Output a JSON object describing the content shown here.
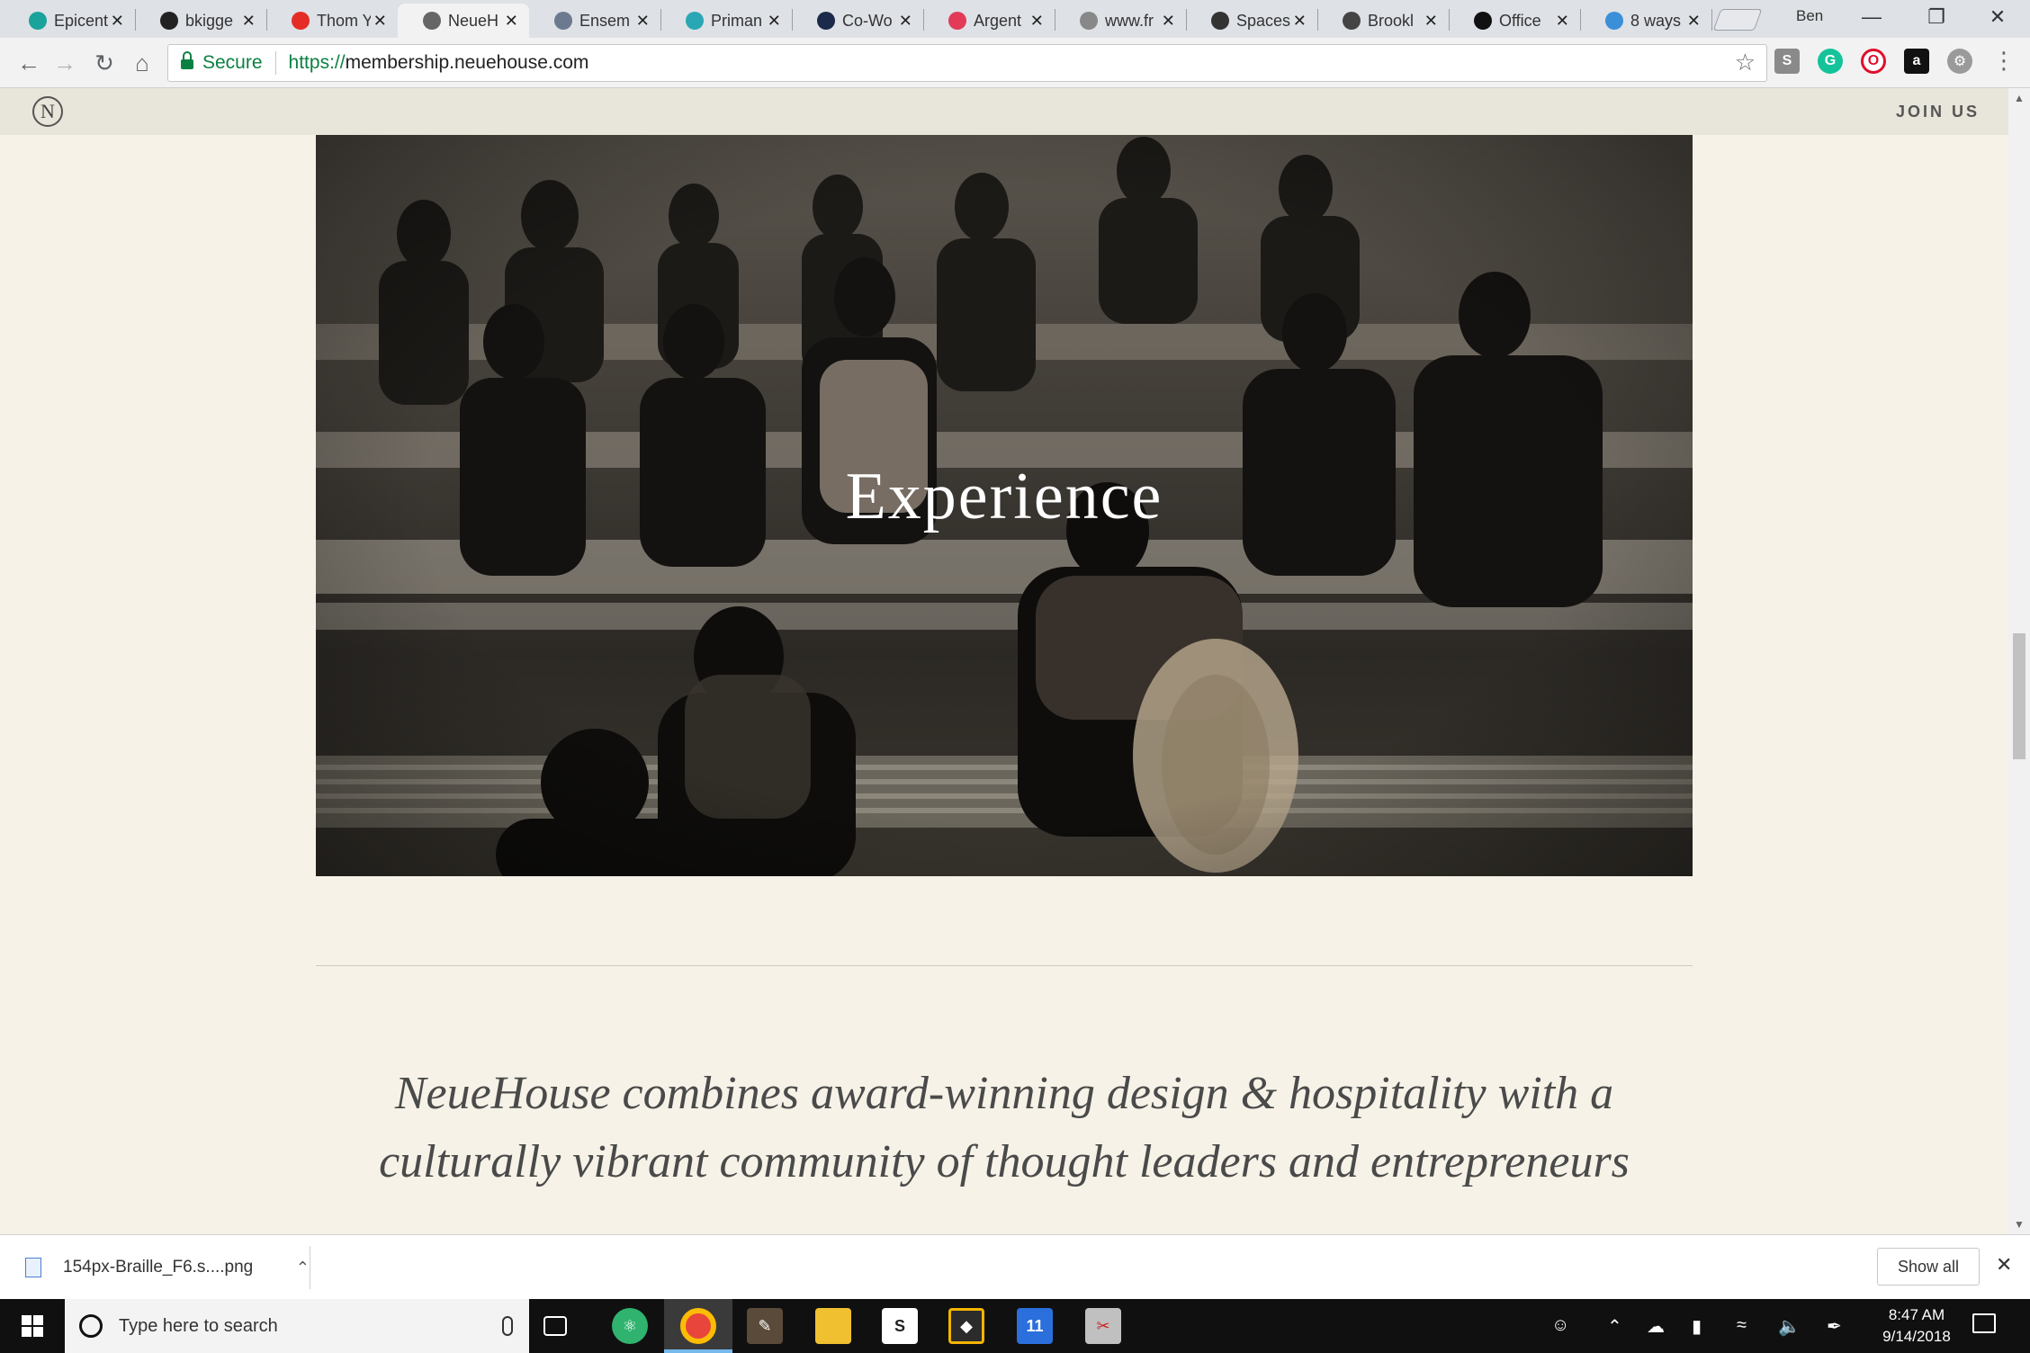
{
  "browser": {
    "tabs": [
      {
        "title": "Epicent",
        "favicon": "epicenter-icon",
        "color": "#1aa39a"
      },
      {
        "title": "bkigge",
        "favicon": "github-icon",
        "color": "#222222"
      },
      {
        "title": "Thom Y",
        "favicon": "youtube-icon",
        "color": "#e52d27"
      },
      {
        "title": "NeueH",
        "favicon": "neuehouse-icon",
        "color": "#666666",
        "active": true
      },
      {
        "title": "Ensem",
        "favicon": "ensemble-icon",
        "color": "#6b7a8f"
      },
      {
        "title": "Priman",
        "favicon": "primary-icon",
        "color": "#2aa7b5"
      },
      {
        "title": "Co-Wo",
        "favicon": "coworking-icon",
        "color": "#1b2a4a"
      },
      {
        "title": "Argent",
        "favicon": "argent-icon",
        "color": "#e23b57"
      },
      {
        "title": "www.fr",
        "favicon": "page-icon",
        "color": "#888888"
      },
      {
        "title": "Spaces",
        "favicon": "spaces-icon",
        "color": "#333333"
      },
      {
        "title": "Brookl",
        "favicon": "brooklyn-icon",
        "color": "#444444"
      },
      {
        "title": "Office",
        "favicon": "office-icon",
        "color": "#111111"
      },
      {
        "title": "8 ways",
        "favicon": "eightways-icon",
        "color": "#3b8fd9"
      }
    ],
    "profile_name": "Ben",
    "secure_label": "Secure",
    "url_scheme": "https://",
    "url_host": "membership.neuehouse.com"
  },
  "site": {
    "logo_letter": "N",
    "join_label": "JOIN US",
    "hero_title": "Experience",
    "tagline": "NeueHouse combines award-winning design & hospitality with a culturally vibrant community of thought leaders and entrepreneurs"
  },
  "downloads": {
    "file_name": "154px-Braille_F6.s....png",
    "show_all_label": "Show all"
  },
  "taskbar": {
    "search_placeholder": "Type here to search",
    "time": "8:47 AM",
    "date": "9/14/2018",
    "calendar_day": "11"
  }
}
